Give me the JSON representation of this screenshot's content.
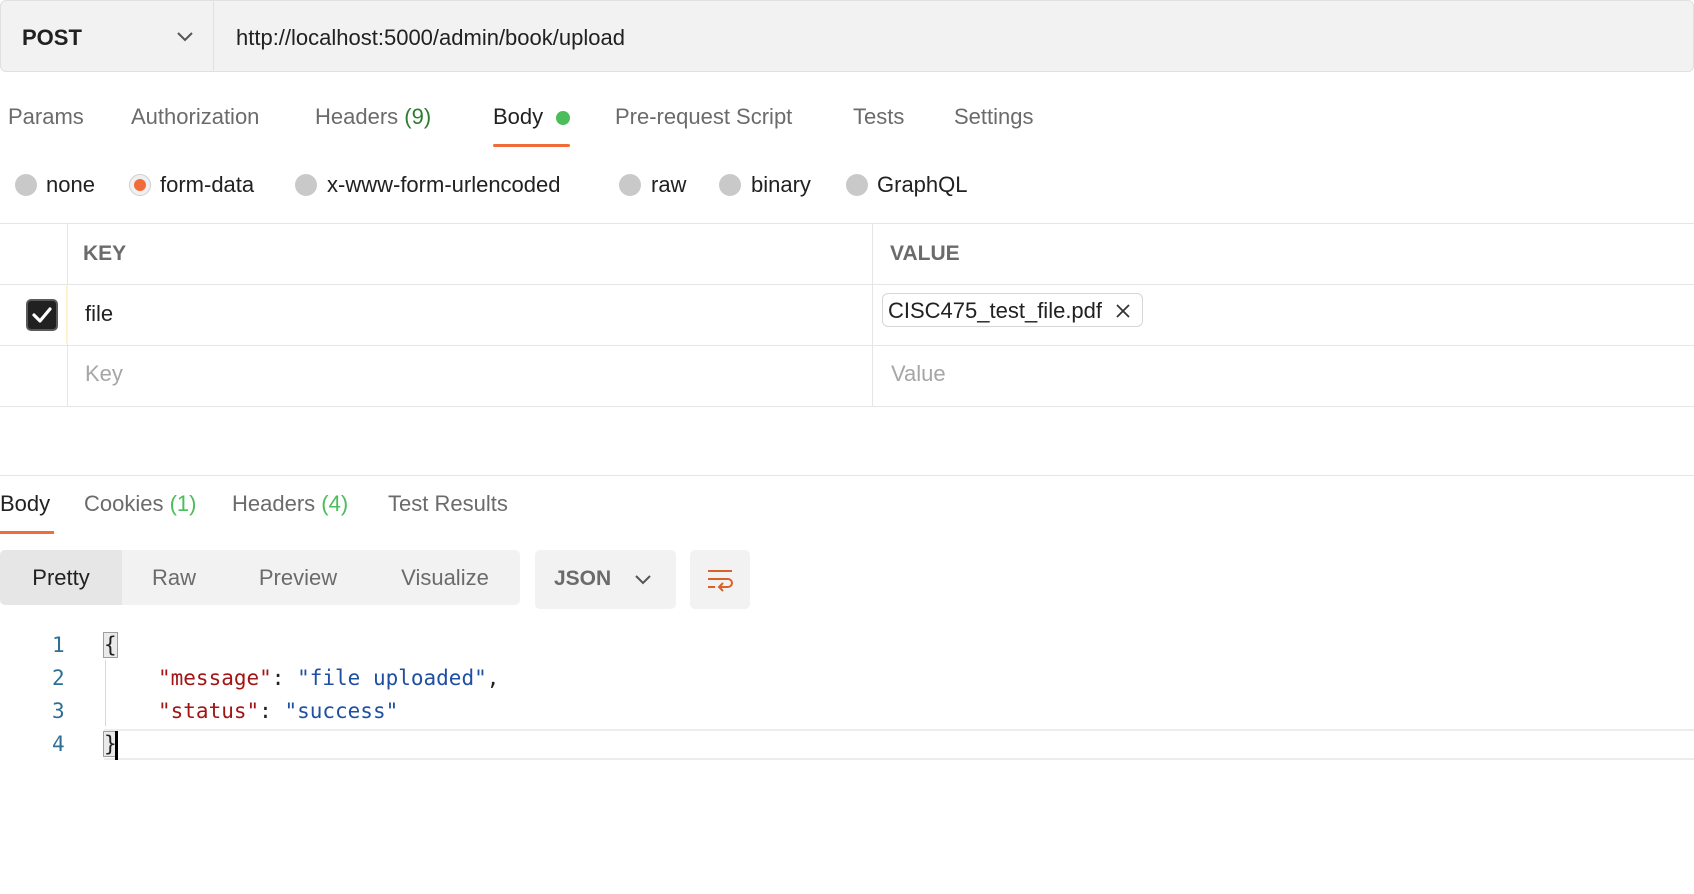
{
  "request": {
    "method": "POST",
    "url": "http://localhost:5000/admin/book/upload"
  },
  "request_tabs": [
    {
      "label": "Params"
    },
    {
      "label": "Authorization"
    },
    {
      "label": "Headers",
      "count": "(9)"
    },
    {
      "label": "Body",
      "active": true,
      "indicator_color": "#4bbd5a"
    },
    {
      "label": "Pre-request Script"
    },
    {
      "label": "Tests"
    },
    {
      "label": "Settings"
    }
  ],
  "body_types": {
    "selected": "form-data",
    "options": [
      "none",
      "form-data",
      "x-www-form-urlencoded",
      "raw",
      "binary",
      "GraphQL"
    ]
  },
  "kv_table": {
    "headers": {
      "key": "KEY",
      "value": "VALUE"
    },
    "rows": [
      {
        "checked": true,
        "key": "file",
        "value_file": "CISC475_test_file.pdf"
      }
    ],
    "placeholder": {
      "key": "Key",
      "value": "Value"
    }
  },
  "response_tabs": [
    {
      "label": "Body",
      "active": true
    },
    {
      "label": "Cookies",
      "count": "(1)"
    },
    {
      "label": "Headers",
      "count": "(4)"
    },
    {
      "label": "Test Results"
    }
  ],
  "view_modes": {
    "selected": "Pretty",
    "options": [
      "Pretty",
      "Raw",
      "Preview",
      "Visualize"
    ]
  },
  "format": "JSON",
  "response_body": {
    "line_numbers": [
      "1",
      "2",
      "3",
      "4"
    ],
    "open_brace": "{",
    "close_brace": "}",
    "fields": [
      {
        "key": "\"message\"",
        "value": "\"file uploaded\"",
        "comma": ","
      },
      {
        "key": "\"status\"",
        "value": "\"success\"",
        "comma": ""
      }
    ]
  },
  "colors": {
    "accent": "#f26b3a",
    "count_green": "#4bbd5a",
    "json_key": "#a31515",
    "json_string": "#1f4fa3"
  }
}
